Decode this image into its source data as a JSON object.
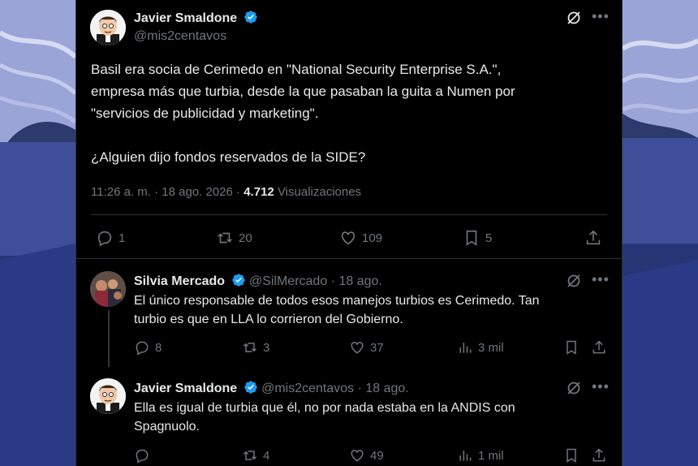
{
  "main_tweet": {
    "author_name": "Javier Smaldone",
    "author_handle": "@mis2centavos",
    "text": "Basil era socia de Cerimedo en \"National Security Enterprise S.A.\",\nempresa más que turbia, desde la que pasaban la guita a Numen por\n\"servicios de publicidad y marketing\".\n\n¿Alguien dijo fondos reservados de la SIDE?",
    "time": "11:26 a. m.",
    "sep": "·",
    "date": "18 ago. 2026",
    "views_count": "4.712",
    "views_label": "Visualizaciones",
    "replies": "1",
    "reposts": "20",
    "likes": "109",
    "bookmarks": "5"
  },
  "replies": [
    {
      "author_name": "Silvia Mercado",
      "author_handle": "@SilMercado",
      "date": "· 18 ago.",
      "text": "El único responsable de todos esos manejos turbios es Cerimedo. Tan\nturbio es que en LLA lo corrieron del Gobierno.",
      "replies": "8",
      "reposts": "3",
      "likes": "37",
      "views": "3 mil"
    },
    {
      "author_name": "Javier Smaldone",
      "author_handle": "@mis2centavos",
      "date": "· 18 ago.",
      "text": "Ella es igual de turbia que él, no por nada estaba en la ANDIS con\nSpagnuolo.",
      "reposts": "4",
      "likes": "49",
      "views": "1 mil"
    }
  ],
  "colors": {
    "background": "#000000",
    "text": "#e7e9ea",
    "muted": "#71767b",
    "border": "#2f3336",
    "verified": "#1d9bf0"
  }
}
